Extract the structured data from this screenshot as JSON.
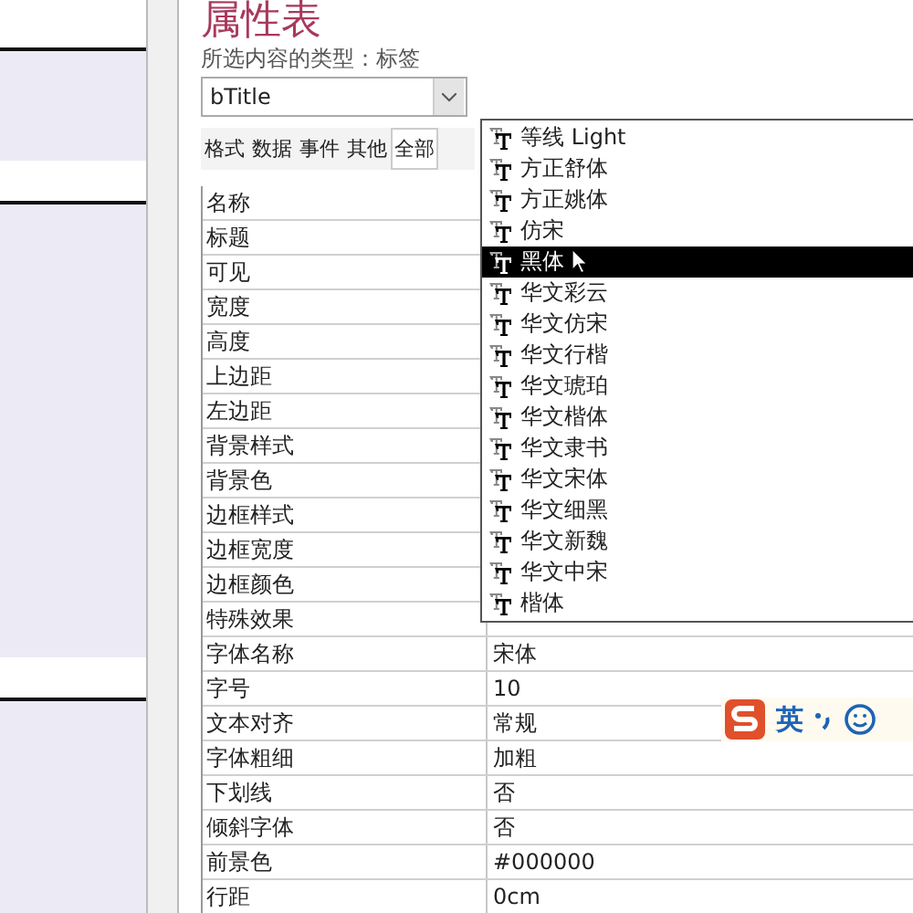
{
  "panel": {
    "title": "属性表",
    "selection_type": "所选内容的类型：标签",
    "object_combo": {
      "value": "bTitle"
    },
    "tabs": [
      {
        "label": "格式",
        "selected": false
      },
      {
        "label": "数据",
        "selected": false
      },
      {
        "label": "事件",
        "selected": false
      },
      {
        "label": "其他",
        "selected": false
      },
      {
        "label": "全部",
        "selected": true
      }
    ],
    "properties": [
      {
        "name": "名称"
      },
      {
        "name": "标题"
      },
      {
        "name": "可见"
      },
      {
        "name": "宽度"
      },
      {
        "name": "高度"
      },
      {
        "name": "上边距"
      },
      {
        "name": "左边距"
      },
      {
        "name": "背景样式"
      },
      {
        "name": "背景色"
      },
      {
        "name": "边框样式"
      },
      {
        "name": "边框宽度"
      },
      {
        "name": "边框颜色"
      },
      {
        "name": "特殊效果"
      },
      {
        "name": "字体名称",
        "value": "宋体"
      },
      {
        "name": "字号",
        "value": "10"
      },
      {
        "name": "文本对齐",
        "value": "常规"
      },
      {
        "name": "字体粗细",
        "value": "加粗"
      },
      {
        "name": "下划线",
        "value": "否"
      },
      {
        "name": "倾斜字体",
        "value": "否"
      },
      {
        "name": "前景色",
        "value": "#000000"
      },
      {
        "name": "行距",
        "value": "0cm"
      }
    ],
    "font_dropdown": {
      "items": [
        {
          "label": "等线 Light",
          "selected": false
        },
        {
          "label": "方正舒体",
          "selected": false
        },
        {
          "label": "方正姚体",
          "selected": false
        },
        {
          "label": "仿宋",
          "selected": false
        },
        {
          "label": "黑体",
          "selected": true
        },
        {
          "label": "华文彩云",
          "selected": false
        },
        {
          "label": "华文仿宋",
          "selected": false
        },
        {
          "label": "华文行楷",
          "selected": false
        },
        {
          "label": "华文琥珀",
          "selected": false
        },
        {
          "label": "华文楷体",
          "selected": false
        },
        {
          "label": "华文隶书",
          "selected": false
        },
        {
          "label": "华文宋体",
          "selected": false
        },
        {
          "label": "华文细黑",
          "selected": false
        },
        {
          "label": "华文新魏",
          "selected": false
        },
        {
          "label": "华文中宋",
          "selected": false
        },
        {
          "label": "楷体",
          "selected": false
        }
      ]
    }
  },
  "ime_toolbar": {
    "mode": "英"
  }
}
